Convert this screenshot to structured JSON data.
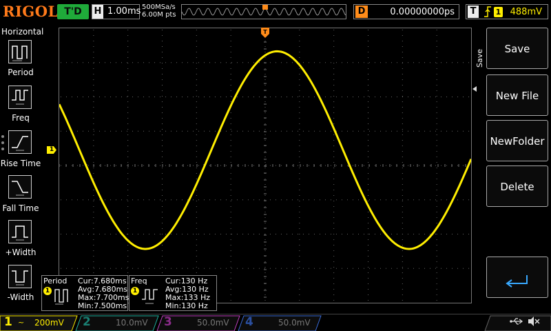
{
  "brand": "RIGOL",
  "run_status": "T'D",
  "horizontal": {
    "label": "H",
    "timebase": "1.00ms",
    "sample_rate": "500MSa/s",
    "memory_depth": "6.00M pts"
  },
  "delay": {
    "label": "D",
    "value": "0.00000000ps"
  },
  "trigger": {
    "label": "T",
    "channel": "1",
    "level": "488mV",
    "icon": "rising-edge-icon"
  },
  "left_menu": {
    "title": "Horizontal",
    "items": [
      {
        "label": "Period",
        "icon": "period-icon"
      },
      {
        "label": "Freq",
        "icon": "freq-icon"
      },
      {
        "label": "Rise Time",
        "icon": "rise-time-icon"
      },
      {
        "label": "Fall Time",
        "icon": "fall-time-icon"
      },
      {
        "label": "+Width",
        "icon": "positive-width-icon"
      },
      {
        "label": "-Width",
        "icon": "negative-width-icon"
      }
    ]
  },
  "right_menu": {
    "title": "Save",
    "buttons": [
      "Save",
      "New File",
      "NewFolder",
      "Delete"
    ],
    "return_icon": "return-icon"
  },
  "channel1_marker": "1",
  "measurements": [
    {
      "name": "Period",
      "channel": "1",
      "cur": "Cur:7.680ms",
      "avg": "Avg:7.680ms",
      "max": "Max:7.700ms",
      "min": "Min:7.500ms"
    },
    {
      "name": "Freq",
      "channel": "1",
      "cur": "Cur:130 Hz",
      "avg": "Avg:130 Hz",
      "max": "Max:133 Hz",
      "min": "Min:130 Hz"
    }
  ],
  "channels": [
    {
      "num": "1",
      "coupling": "~",
      "scale": "200mV",
      "color": "#ffee00",
      "active": true
    },
    {
      "num": "2",
      "coupling": "",
      "scale": "10.0mV",
      "color": "#1fb3a0",
      "active": false
    },
    {
      "num": "3",
      "coupling": "",
      "scale": "50.0mV",
      "color": "#c040c0",
      "active": false
    },
    {
      "num": "4",
      "coupling": "",
      "scale": "50.0mV",
      "color": "#3a6bd9",
      "active": false
    }
  ],
  "waveform": {
    "channel": "1",
    "color": "#ffee00",
    "frequency_hz": 130,
    "period_ms": 7.68
  },
  "colors": {
    "accent": "#ff7a1a",
    "ch1": "#ffee00",
    "run": "#1faa3a",
    "delay": "#ff8c1a"
  }
}
